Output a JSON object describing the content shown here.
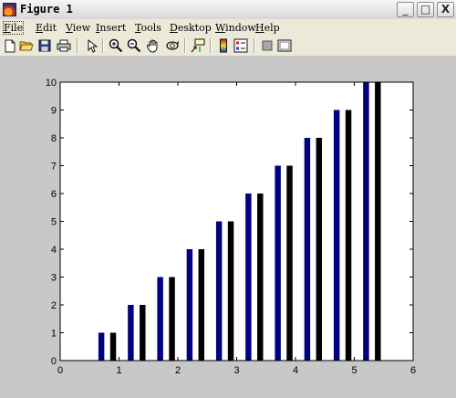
{
  "window": {
    "title": "Figure 1",
    "min_label": "_",
    "max_label": "□",
    "close_label": "X"
  },
  "menu": {
    "items": [
      {
        "label": "File",
        "key": "F",
        "rest": "ile"
      },
      {
        "label": "Edit",
        "key": "E",
        "rest": "dit"
      },
      {
        "label": "View",
        "key": "V",
        "rest": "iew"
      },
      {
        "label": "Insert",
        "key": "I",
        "rest": "nsert"
      },
      {
        "label": "Tools",
        "key": "T",
        "rest": "ools"
      },
      {
        "label": "Desktop",
        "key": "D",
        "rest": "esktop"
      },
      {
        "label": "Window",
        "key": "W",
        "rest": "indow"
      },
      {
        "label": "Help",
        "key": "H",
        "rest": "elp"
      }
    ]
  },
  "toolbar": {
    "buttons": [
      {
        "name": "new-figure-icon"
      },
      {
        "name": "open-file-icon"
      },
      {
        "name": "save-icon"
      },
      {
        "name": "print-icon"
      },
      {
        "name": "edit-plot-arrow-icon"
      },
      {
        "name": "zoom-in-icon"
      },
      {
        "name": "zoom-out-icon"
      },
      {
        "name": "pan-hand-icon"
      },
      {
        "name": "rotate-3d-icon"
      },
      {
        "name": "data-cursor-icon"
      },
      {
        "name": "insert-colorbar-icon"
      },
      {
        "name": "insert-legend-icon"
      },
      {
        "name": "hide-plot-tools-icon"
      },
      {
        "name": "show-plot-tools-icon"
      }
    ]
  },
  "colors": {
    "series_1": "#000080",
    "series_2": "#000000",
    "plot_background": "#ffffff",
    "figure_background": "#c8c8c8"
  },
  "chart_data": {
    "type": "bar",
    "title": "",
    "xlabel": "",
    "ylabel": "",
    "xlim": [
      0,
      6
    ],
    "ylim": [
      0,
      10
    ],
    "xticks": [
      "0",
      "1",
      "2",
      "3",
      "4",
      "5",
      "6"
    ],
    "yticks": [
      "0",
      "1",
      "2",
      "3",
      "4",
      "5",
      "6",
      "7",
      "8",
      "9",
      "10"
    ],
    "grid": false,
    "legend": "none",
    "x": [
      0.8,
      1.3,
      1.8,
      2.3,
      2.8,
      3.3,
      3.8,
      4.3,
      4.8,
      5.3
    ],
    "series": [
      {
        "values": [
          1,
          2,
          3,
          4,
          5,
          6,
          7,
          8,
          9,
          10
        ],
        "color": "#000080"
      },
      {
        "values": [
          1,
          2,
          3,
          4,
          5,
          6,
          7,
          8,
          9,
          10
        ],
        "color": "#000000"
      }
    ]
  }
}
